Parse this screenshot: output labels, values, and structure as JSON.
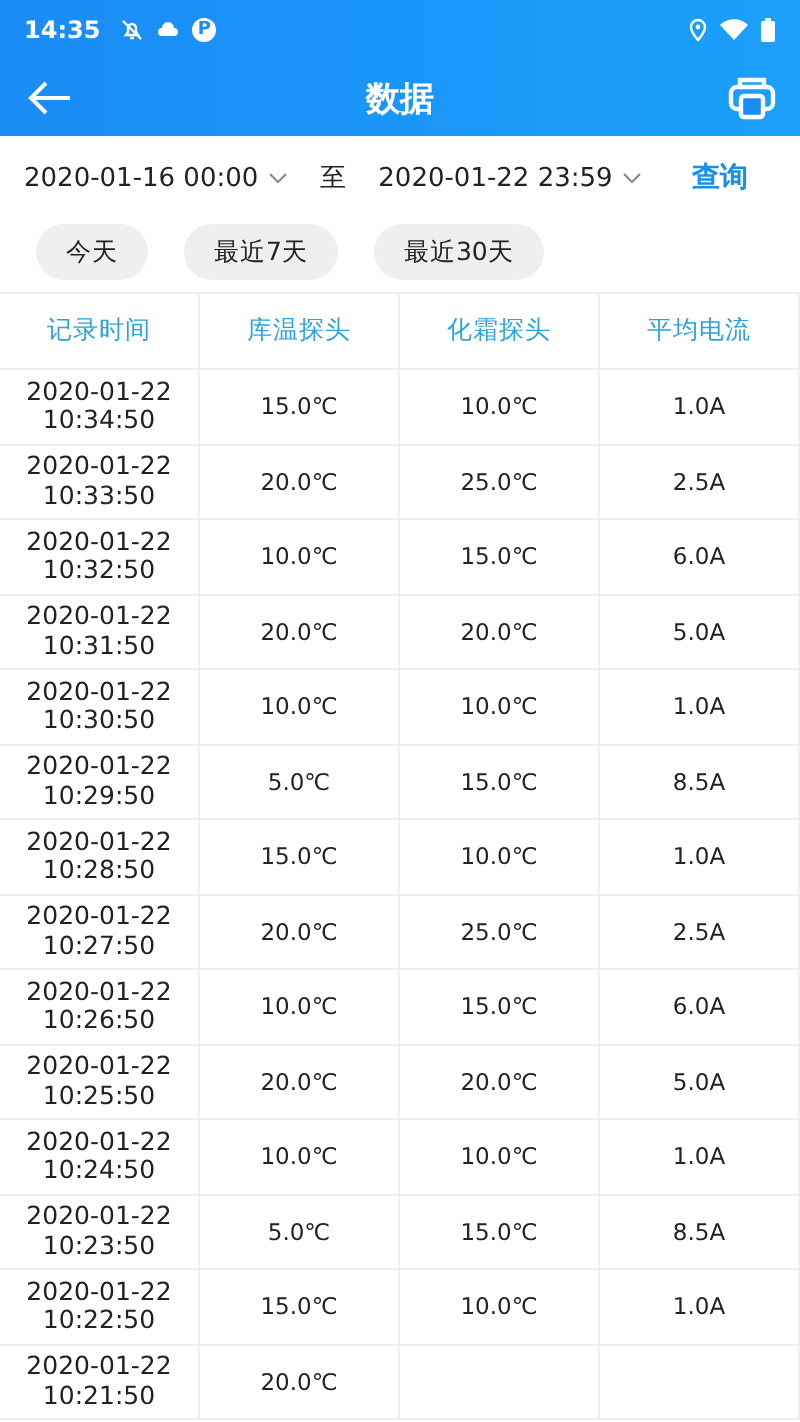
{
  "status_bar": {
    "time": "14:35",
    "badge": "P"
  },
  "header": {
    "title": "数据"
  },
  "filter": {
    "start": "2020-01-16 00:00",
    "separator": "至",
    "end": "2020-01-22 23:59",
    "query": "查询"
  },
  "chips": [
    {
      "label": "今天"
    },
    {
      "label": "最近7天"
    },
    {
      "label": "最近30天"
    }
  ],
  "table": {
    "columns": [
      "记录时间",
      "库温探头",
      "化霜探头",
      "平均电流"
    ],
    "rows": [
      [
        "2020-01-22 10:34:50",
        "15.0℃",
        "10.0℃",
        "1.0A"
      ],
      [
        "2020-01-22 10:33:50",
        "20.0℃",
        "25.0℃",
        "2.5A"
      ],
      [
        "2020-01-22 10:32:50",
        "10.0℃",
        "15.0℃",
        "6.0A"
      ],
      [
        "2020-01-22 10:31:50",
        "20.0℃",
        "20.0℃",
        "5.0A"
      ],
      [
        "2020-01-22 10:30:50",
        "10.0℃",
        "10.0℃",
        "1.0A"
      ],
      [
        "2020-01-22 10:29:50",
        "5.0℃",
        "15.0℃",
        "8.5A"
      ],
      [
        "2020-01-22 10:28:50",
        "15.0℃",
        "10.0℃",
        "1.0A"
      ],
      [
        "2020-01-22 10:27:50",
        "20.0℃",
        "25.0℃",
        "2.5A"
      ],
      [
        "2020-01-22 10:26:50",
        "10.0℃",
        "15.0℃",
        "6.0A"
      ],
      [
        "2020-01-22 10:25:50",
        "20.0℃",
        "20.0℃",
        "5.0A"
      ],
      [
        "2020-01-22 10:24:50",
        "10.0℃",
        "10.0℃",
        "1.0A"
      ],
      [
        "2020-01-22 10:23:50",
        "5.0℃",
        "15.0℃",
        "8.5A"
      ],
      [
        "2020-01-22 10:22:50",
        "15.0℃",
        "10.0℃",
        "1.0A"
      ],
      [
        "2020-01-22 10:21:50",
        "20.0℃"
      ]
    ]
  }
}
